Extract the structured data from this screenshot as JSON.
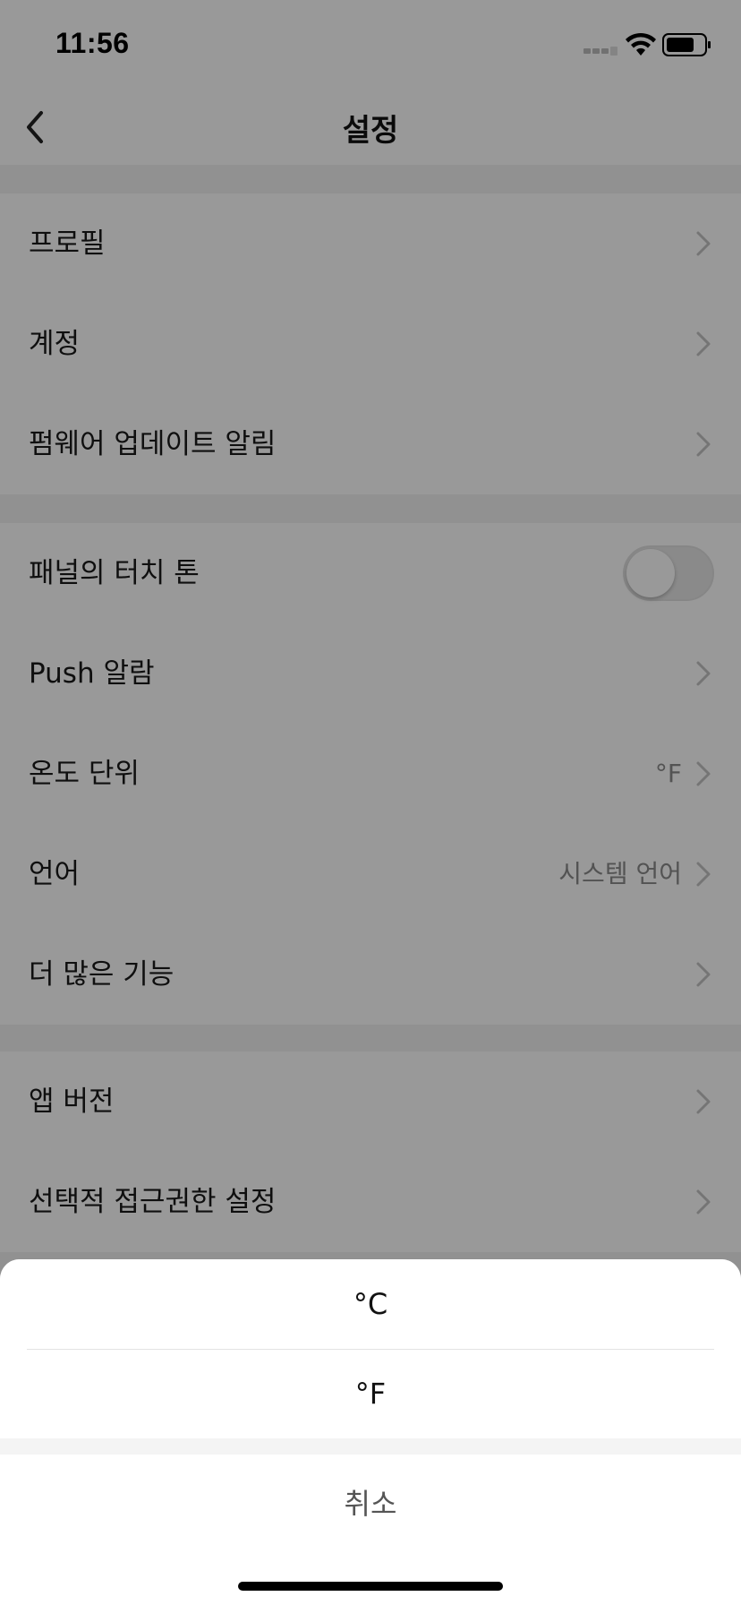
{
  "status_bar": {
    "time": "11:56"
  },
  "nav": {
    "title": "설정"
  },
  "groups": [
    {
      "rows": [
        {
          "label": "프로필",
          "value": ""
        },
        {
          "label": "계정",
          "value": ""
        },
        {
          "label": "펌웨어 업데이트 알림",
          "value": ""
        }
      ]
    },
    {
      "rows": [
        {
          "label": "패널의 터치 톤",
          "value": "",
          "toggle": false
        },
        {
          "label": "Push 알람",
          "value": ""
        },
        {
          "label": "온도 단위",
          "value": "°F"
        },
        {
          "label": "언어",
          "value": "시스템 언어"
        },
        {
          "label": "더 많은 기능",
          "value": ""
        }
      ]
    },
    {
      "rows": [
        {
          "label": "앱 버전",
          "value": ""
        },
        {
          "label": "선택적 접근권한 설정",
          "value": ""
        }
      ]
    }
  ],
  "action_sheet": {
    "options": [
      "°C",
      "°F"
    ],
    "cancel_label": "취소"
  },
  "colors": {
    "page_background": "#f2f2f2",
    "row_background": "#ffffff",
    "overlay": "rgba(0,0,0,0.4)",
    "secondary_text": "#8a8a8a"
  },
  "icons": {
    "back": "chevron-left-icon",
    "row_arrow": "chevron-right-icon",
    "signal": "cellular-signal-icon",
    "wifi": "wifi-icon",
    "battery": "battery-icon"
  }
}
